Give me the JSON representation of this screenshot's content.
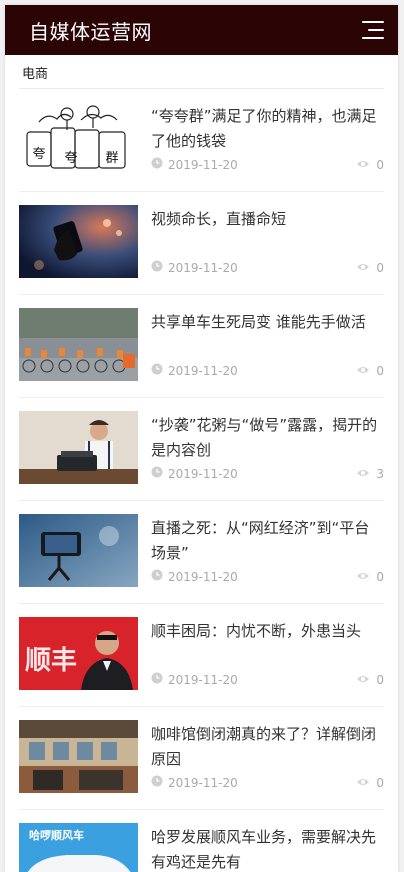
{
  "header": {
    "site_title": "自媒体运营网"
  },
  "section": {
    "title": "电商"
  },
  "articles": [
    {
      "title": "“夸夸群”满足了你的精神，也满足了他的钱袋",
      "date": "2019-11-20",
      "views": "0"
    },
    {
      "title": "视频命长，直播命短",
      "date": "2019-11-20",
      "views": "0"
    },
    {
      "title": "共享单车生死局变 谁能先手做活",
      "date": "2019-11-20",
      "views": "0"
    },
    {
      "title": "“抄袭”花粥与“做号”露露，揭开的是内容创",
      "date": "2019-11-20",
      "views": "3"
    },
    {
      "title": "直播之死：从“网红经济”到“平台场景”",
      "date": "2019-11-20",
      "views": "0"
    },
    {
      "title": "顺丰困局：内忧不断，外患当头",
      "date": "2019-11-20",
      "views": "0"
    },
    {
      "title": "咖啡馆倒闭潮真的来了？详解倒闭原因",
      "date": "2019-11-20",
      "views": "0"
    },
    {
      "title": "哈罗发展顺风车业务，需要解决先有鸡还是先有",
      "date": "",
      "views": ""
    }
  ],
  "thumb_text": {
    "cartoon_chars": [
      "夸",
      "夸",
      "群"
    ],
    "sf_sign": "顺丰",
    "hello_sign": "哈啰顺风车"
  },
  "colors": {
    "header_bg": "#2b0505",
    "meta_text": "#aaaaaa",
    "title_text": "#333333"
  },
  "icons": {
    "menu": "hamburger-menu-icon",
    "date": "clock-icon",
    "views": "eye-icon"
  }
}
